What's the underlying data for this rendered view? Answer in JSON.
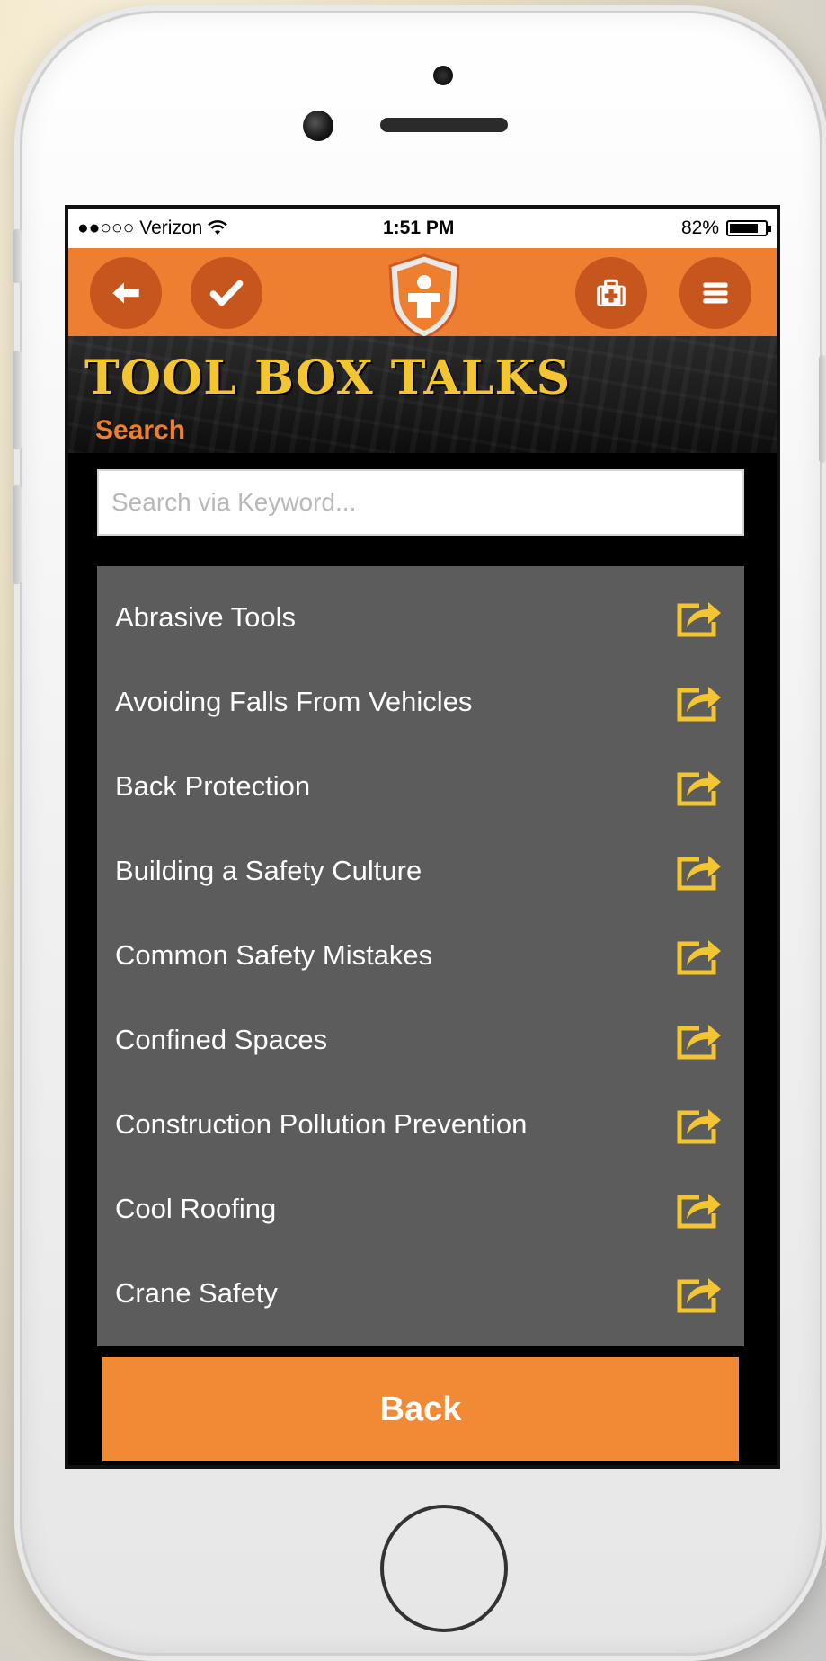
{
  "status_bar": {
    "carrier": "●●○○○ Verizon",
    "time": "1:51 PM",
    "battery_text": "82%",
    "battery_level": 0.82
  },
  "nav": {
    "icons": [
      "back-arrow-icon",
      "checkmark-icon",
      "shield-logo-icon",
      "first-aid-kit-icon",
      "hamburger-menu-icon"
    ]
  },
  "banner": {
    "title": "TOOL BOX TALKS",
    "subtitle": "Search"
  },
  "search": {
    "placeholder": "Search via Keyword...",
    "value": ""
  },
  "topics": [
    {
      "label": "Abrasive Tools"
    },
    {
      "label": "Avoiding Falls From Vehicles"
    },
    {
      "label": "Back Protection"
    },
    {
      "label": "Building a Safety Culture"
    },
    {
      "label": "Common Safety Mistakes"
    },
    {
      "label": "Confined Spaces"
    },
    {
      "label": "Construction Pollution Prevention"
    },
    {
      "label": "Cool Roofing"
    },
    {
      "label": "Crane Safety"
    }
  ],
  "footer": {
    "back_label": "Back"
  },
  "colors": {
    "accent_orange": "#ef7f30",
    "dark_orange": "#c7551e",
    "title_yellow": "#f2c531",
    "list_bg": "#5c5c5d",
    "share_icon_yellow": "#f2c531"
  }
}
